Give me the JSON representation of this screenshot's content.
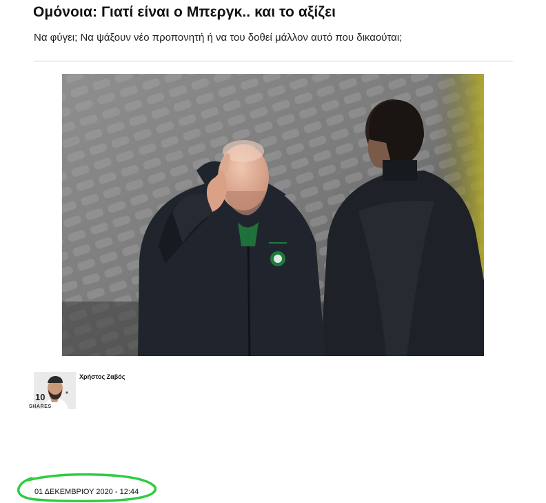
{
  "article": {
    "title": "Ομόνοια: Γιατί είναι ο Μπεργκ.. και το αξίζει",
    "subtitle": "Να φύγει; Να ψάξουν νέο προπονητή ή να του δοθεί μάλλον αυτό που δικαούται;",
    "author": {
      "name": "Χρήστος Ζαβός"
    },
    "shares": {
      "count": "10",
      "label": "SHARES"
    },
    "published": "01 ΔΕΚΕΜΒΡΙΟΥ 2020 - 12:44"
  },
  "colors": {
    "highlight": "#2ecc40",
    "divider": "#cfcfcf",
    "text": "#111111"
  }
}
